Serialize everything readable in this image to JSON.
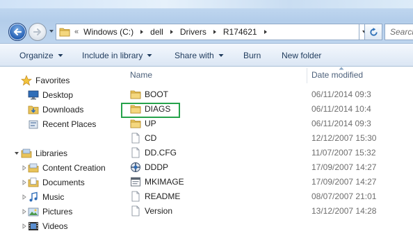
{
  "address_bar": {
    "overflow_chevron": "«",
    "breadcrumbs": [
      "Windows (C:)",
      "dell",
      "Drivers",
      "R174621"
    ],
    "search_placeholder": "Search"
  },
  "toolbar": {
    "organize": "Organize",
    "include_in_library": "Include in library",
    "share_with": "Share with",
    "burn": "Burn",
    "new_folder": "New folder"
  },
  "navigation": {
    "favorites": {
      "label": "Favorites",
      "items": [
        {
          "label": "Desktop",
          "icon": "desktop-icon"
        },
        {
          "label": "Downloads",
          "icon": "downloads-folder-icon"
        },
        {
          "label": "Recent Places",
          "icon": "recent-places-icon"
        }
      ]
    },
    "libraries": {
      "label": "Libraries",
      "items": [
        {
          "label": "Content Creation",
          "icon": "library-icon"
        },
        {
          "label": "Documents",
          "icon": "documents-library-icon"
        },
        {
          "label": "Music",
          "icon": "music-library-icon"
        },
        {
          "label": "Pictures",
          "icon": "pictures-library-icon"
        },
        {
          "label": "Videos",
          "icon": "videos-library-icon"
        }
      ]
    }
  },
  "file_list": {
    "columns": {
      "name": "Name",
      "date_modified": "Date modified"
    },
    "rows": [
      {
        "name": "BOOT",
        "date": "06/11/2014 09:3",
        "type": "folder"
      },
      {
        "name": "DIAGS",
        "date": "06/11/2014 10:4",
        "type": "folder",
        "highlighted": true
      },
      {
        "name": "UP",
        "date": "06/11/2014 09:3",
        "type": "folder"
      },
      {
        "name": "CD",
        "date": "12/12/2007 15:30",
        "type": "file"
      },
      {
        "name": "DD.CFG",
        "date": "11/07/2007 15:32",
        "type": "file"
      },
      {
        "name": "DDDP",
        "date": "17/09/2007 14:27",
        "type": "executable"
      },
      {
        "name": "MKIMAGE",
        "date": "17/09/2007 14:27",
        "type": "batch"
      },
      {
        "name": "README",
        "date": "08/07/2007 21:01",
        "type": "file"
      },
      {
        "name": "Version",
        "date": "13/12/2007 14:28",
        "type": "file"
      }
    ]
  },
  "colors": {
    "highlight_box": "#25a24a",
    "folder_yellow": "#e8c35a",
    "toolbar_text": "#1e3a5c"
  }
}
